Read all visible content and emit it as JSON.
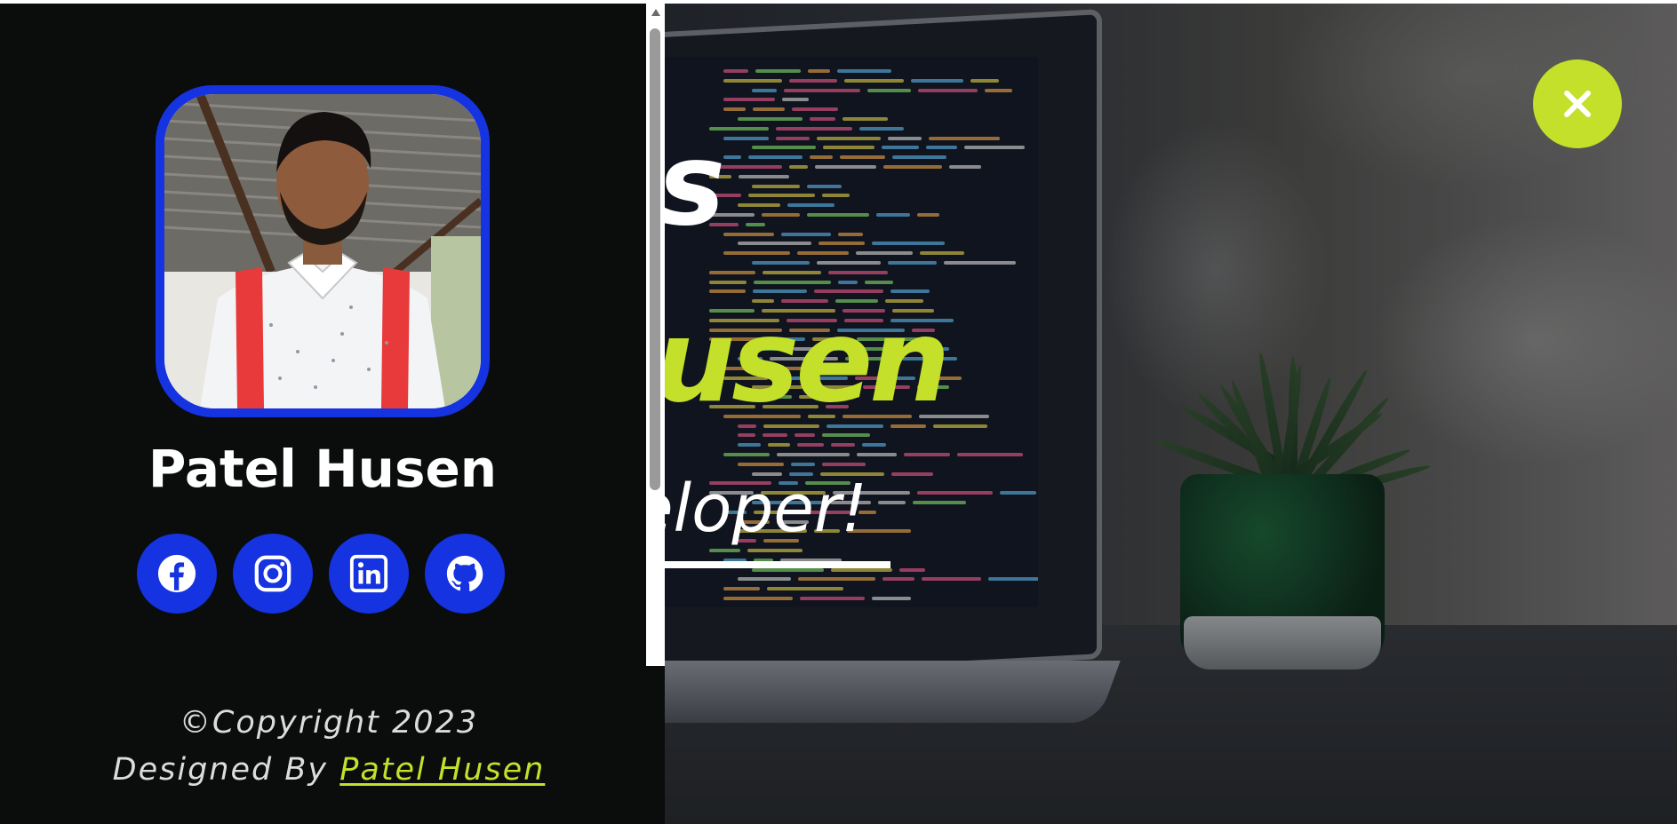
{
  "hero": {
    "line1": "is",
    "line2": "usen",
    "line3": "eloper!"
  },
  "sidebar": {
    "name": "Patel Husen",
    "socials": [
      {
        "name": "facebook-icon"
      },
      {
        "name": "instagram-icon"
      },
      {
        "name": "linkedin-icon"
      },
      {
        "name": "github-icon"
      }
    ],
    "copyright": "©Copyright 2023",
    "designed_prefix": "Designed By ",
    "designed_link": "Patel Husen"
  },
  "colors": {
    "accent": "#c4e02a",
    "brand_blue": "#1533e0",
    "sidebar_bg": "#0b0c0c"
  },
  "icons": {
    "close": "close-icon"
  }
}
